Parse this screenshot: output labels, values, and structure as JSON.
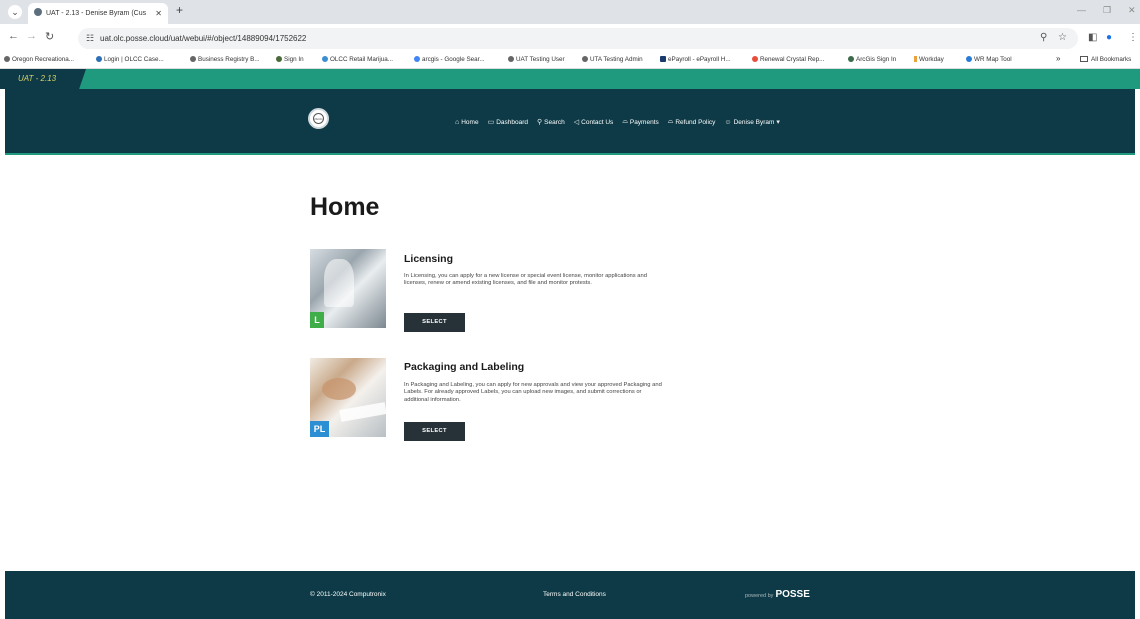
{
  "browser": {
    "tab_title": "UAT - 2.13 - Denise Byram (Cus",
    "url": "uat.olc.posse.cloud/uat/webui/#/object/14889094/1752622",
    "bookmarks": [
      "Oregon Recreationa...",
      "Login | OLCC Case...",
      "Business Registry B...",
      "Sign In",
      "OLCC Retail Marijua...",
      "arcgis - Google Sear...",
      "UAT Testing User",
      "UTA Testing Admin",
      "ePayroll - ePayroll H...",
      "Renewal Crystal Rep...",
      "ArcGis Sign In",
      "Workday",
      "WR Map Tool"
    ],
    "all_bookmarks": "All Bookmarks"
  },
  "env_badge": "UAT - 2.13",
  "nav": {
    "home": "Home",
    "dashboard": "Dashboard",
    "search": "Search",
    "contact": "Contact Us",
    "payments": "Payments",
    "refund": "Refund Policy",
    "user": "Denise Byram"
  },
  "logo_text": "OLCC",
  "page_title": "Home",
  "cards": [
    {
      "title": "Licensing",
      "description": "In Licensing, you can apply for a new license or special event license, monitor applications and licenses, renew or amend existing licenses, and file and monitor protests.",
      "badge": "L",
      "button": "SELECT"
    },
    {
      "title": "Packaging and Labeling",
      "description": "In Packaging and Labeling, you can apply for new approvals and view your approved Packaging and Labels. For already approved Labels, you can upload new images, and submit corrections or additional information.",
      "badge": "PL",
      "button": "SELECT"
    }
  ],
  "footer": {
    "copyright": "© 2011-2024 Computronix",
    "terms": "Terms and Conditions",
    "powered_by": "powered by",
    "brand": "POSSE"
  },
  "colors": {
    "header_bg": "#0d3a46",
    "accent": "#1f9a7e",
    "button_bg": "#263238"
  }
}
